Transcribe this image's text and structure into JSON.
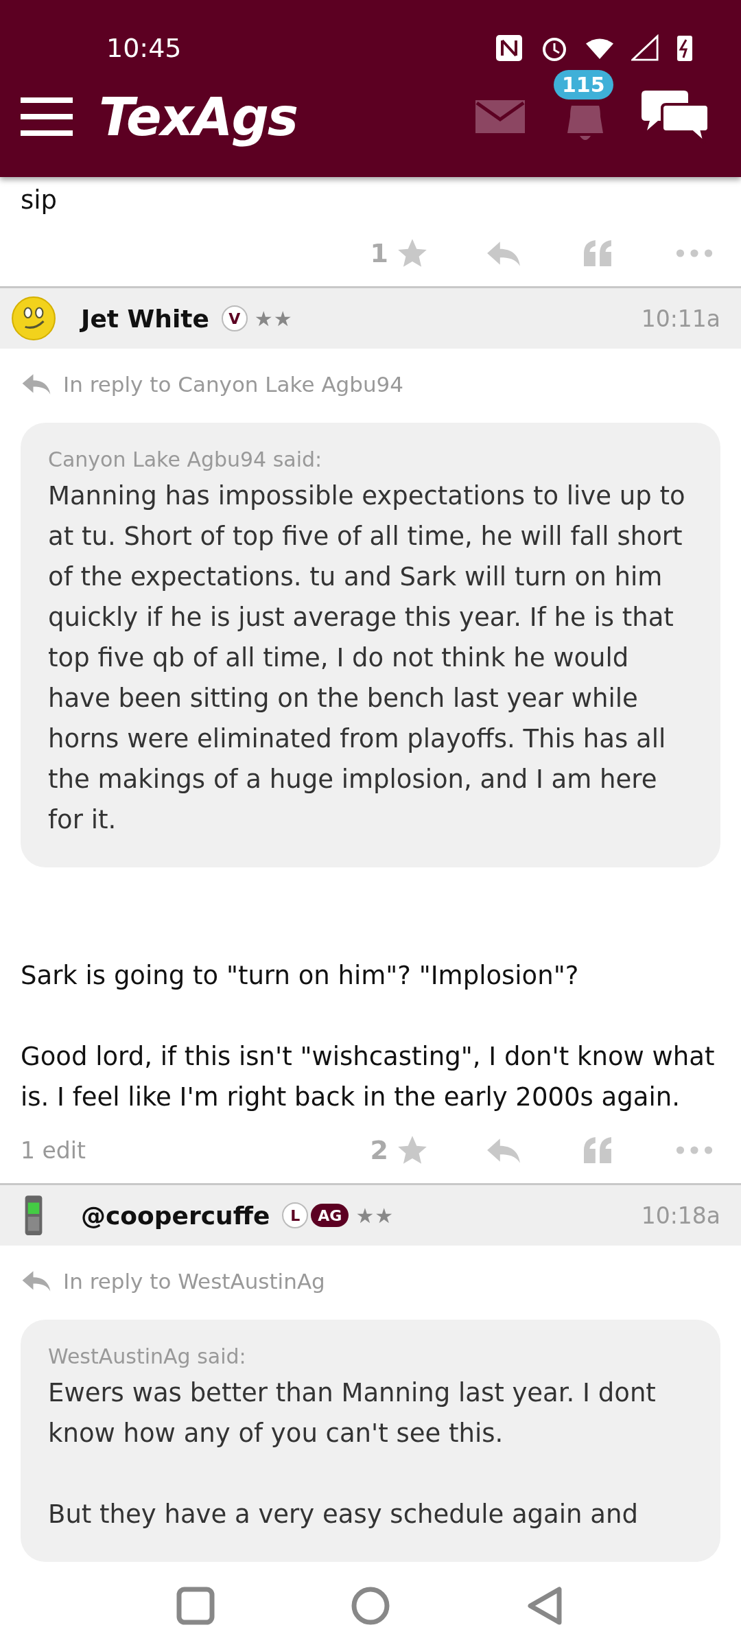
{
  "status_bar": {
    "time": "10:45"
  },
  "app_bar": {
    "logo": "TexAgs",
    "notification_count": "115"
  },
  "posts": [
    {
      "body": [
        "sip"
      ],
      "star_count": "1"
    },
    {
      "author": "Jet White",
      "avatar": {
        "kind": "smiley"
      },
      "badges": [
        {
          "kind": "circle",
          "text": "V"
        }
      ],
      "rank": "★★",
      "time": "10:11a",
      "reply_to": "In reply to Canyon Lake Agbu94",
      "quote": {
        "attribution": "Canyon Lake Agbu94 said:",
        "paragraphs": [
          "Manning has impossible expectations to live up to at tu. Short of top five of all time, he will fall short of the expectations. tu and Sark will turn on him quickly if he is just average this year. If he is that top five qb of all time, I do not think he would have been sitting on the bench last year while horns were eliminated from playoffs. This has all the makings of a huge implosion, and I am here for it."
        ]
      },
      "body": [
        "Sark is going to \"turn on him\"? \"Implosion\"?",
        "Good lord, if this isn't \"wishcasting\", I don't know what is. I feel like I'm right back in the early 2000s again."
      ],
      "edits": "1 edit",
      "star_count": "2"
    },
    {
      "author": "@coopercuffe",
      "avatar": {
        "kind": "phone"
      },
      "badges": [
        {
          "kind": "circle",
          "text": "L"
        },
        {
          "kind": "pill",
          "text": "AG"
        }
      ],
      "rank": "★★",
      "time": "10:18a",
      "reply_to": "In reply to WestAustinAg",
      "quote": {
        "attribution": "WestAustinAg said:",
        "paragraphs": [
          "Ewers was better than Manning last year. I dont know how any of you can't see this.",
          "But they have a very easy schedule again and"
        ]
      }
    }
  ]
}
